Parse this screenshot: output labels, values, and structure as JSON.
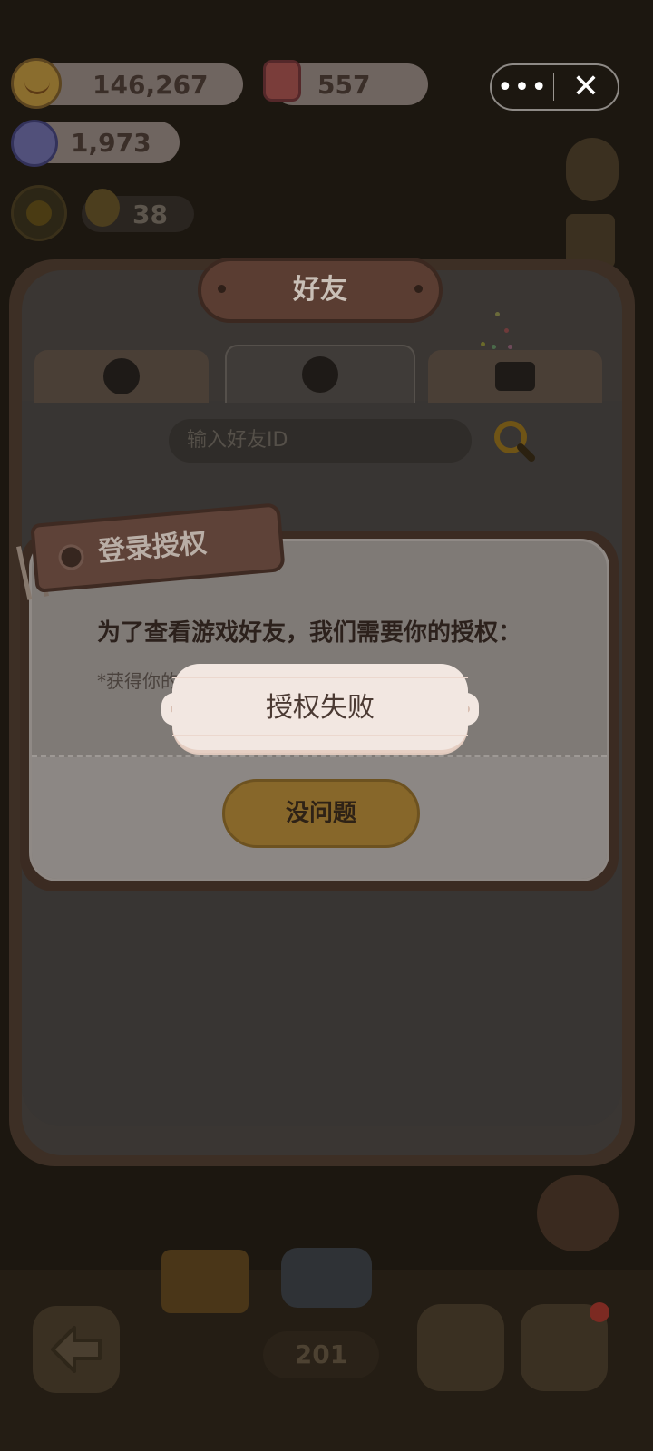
{
  "currencies": {
    "coins": "146,267",
    "gems": "557",
    "candy": "1,973"
  },
  "capsule": {
    "more_label": "•••",
    "close_label": "✕"
  },
  "level": {
    "value": "38"
  },
  "friends_panel": {
    "title": "好友",
    "tabs": [
      {
        "icon": "friends-icon",
        "active": false
      },
      {
        "icon": "add-friend-icon",
        "active": true
      },
      {
        "icon": "bag-icon",
        "active": false
      }
    ],
    "search_placeholder": "输入好友ID"
  },
  "auth_dialog": {
    "tag_title": "登录授权",
    "message": "为了查看游戏好友，我们需要你的授权：",
    "sub_message": "*获得你的",
    "ok_button": "没问题"
  },
  "toast": {
    "text": "授权失败"
  },
  "bottom_bar": {
    "page_number": "201"
  }
}
